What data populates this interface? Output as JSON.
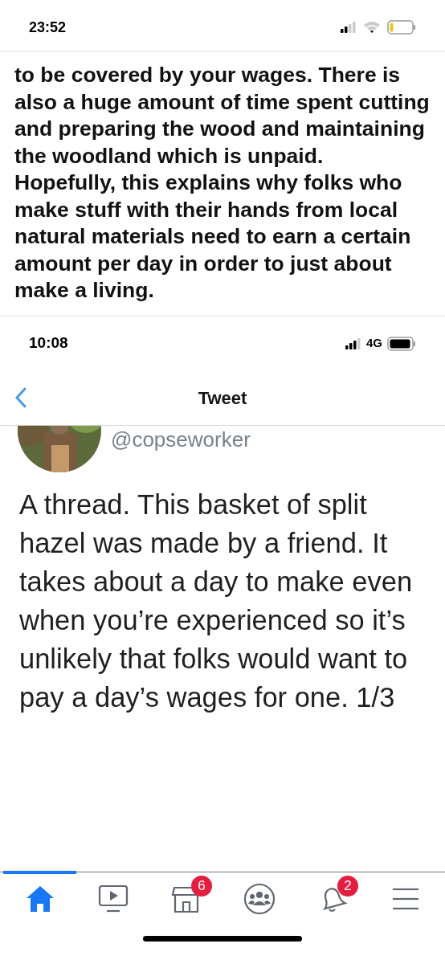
{
  "status_bar": {
    "time": "23:52"
  },
  "post": {
    "paragraphs": [
      "to be covered by your wages. There is also a huge amount of time spent cutting and preparing the wood and maintaining the woodland which is unpaid.",
      "Hopefully, this explains why folks who make stuff with their hands from local natural materials need to earn a certain amount per day in order to just about make a living."
    ]
  },
  "screenshot": {
    "status_bar": {
      "time": "10:08",
      "network": "4G"
    },
    "nav": {
      "title": "Tweet"
    },
    "handle": "@copseworker",
    "text": "A thread. This basket of split hazel was made by a friend. It takes about a day to make even when you’re experienced so it’s unlikely that folks would want to pay a day’s wages for one. 1/3"
  },
  "tab_bar": [
    {
      "kind": "home",
      "selected": true
    },
    {
      "kind": "video",
      "selected": false
    },
    {
      "kind": "marketplace",
      "selected": false,
      "badge": "6"
    },
    {
      "kind": "groups",
      "selected": false
    },
    {
      "kind": "notifications",
      "selected": false,
      "badge": "2"
    },
    {
      "kind": "menu",
      "selected": false
    }
  ]
}
